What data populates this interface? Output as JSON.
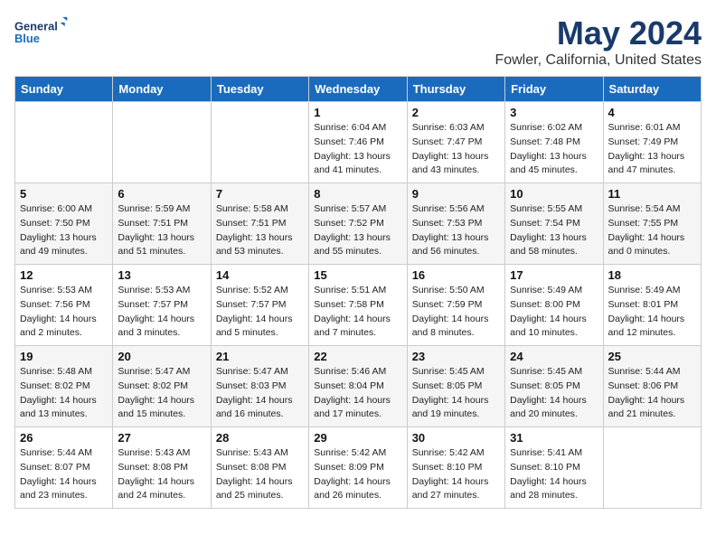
{
  "logo": {
    "line1": "General",
    "line2": "Blue"
  },
  "title": "May 2024",
  "subtitle": "Fowler, California, United States",
  "days_of_week": [
    "Sunday",
    "Monday",
    "Tuesday",
    "Wednesday",
    "Thursday",
    "Friday",
    "Saturday"
  ],
  "weeks": [
    [
      {
        "day": "",
        "sunrise": "",
        "sunset": "",
        "daylight": ""
      },
      {
        "day": "",
        "sunrise": "",
        "sunset": "",
        "daylight": ""
      },
      {
        "day": "",
        "sunrise": "",
        "sunset": "",
        "daylight": ""
      },
      {
        "day": "1",
        "sunrise": "Sunrise: 6:04 AM",
        "sunset": "Sunset: 7:46 PM",
        "daylight": "Daylight: 13 hours and 41 minutes."
      },
      {
        "day": "2",
        "sunrise": "Sunrise: 6:03 AM",
        "sunset": "Sunset: 7:47 PM",
        "daylight": "Daylight: 13 hours and 43 minutes."
      },
      {
        "day": "3",
        "sunrise": "Sunrise: 6:02 AM",
        "sunset": "Sunset: 7:48 PM",
        "daylight": "Daylight: 13 hours and 45 minutes."
      },
      {
        "day": "4",
        "sunrise": "Sunrise: 6:01 AM",
        "sunset": "Sunset: 7:49 PM",
        "daylight": "Daylight: 13 hours and 47 minutes."
      }
    ],
    [
      {
        "day": "5",
        "sunrise": "Sunrise: 6:00 AM",
        "sunset": "Sunset: 7:50 PM",
        "daylight": "Daylight: 13 hours and 49 minutes."
      },
      {
        "day": "6",
        "sunrise": "Sunrise: 5:59 AM",
        "sunset": "Sunset: 7:51 PM",
        "daylight": "Daylight: 13 hours and 51 minutes."
      },
      {
        "day": "7",
        "sunrise": "Sunrise: 5:58 AM",
        "sunset": "Sunset: 7:51 PM",
        "daylight": "Daylight: 13 hours and 53 minutes."
      },
      {
        "day": "8",
        "sunrise": "Sunrise: 5:57 AM",
        "sunset": "Sunset: 7:52 PM",
        "daylight": "Daylight: 13 hours and 55 minutes."
      },
      {
        "day": "9",
        "sunrise": "Sunrise: 5:56 AM",
        "sunset": "Sunset: 7:53 PM",
        "daylight": "Daylight: 13 hours and 56 minutes."
      },
      {
        "day": "10",
        "sunrise": "Sunrise: 5:55 AM",
        "sunset": "Sunset: 7:54 PM",
        "daylight": "Daylight: 13 hours and 58 minutes."
      },
      {
        "day": "11",
        "sunrise": "Sunrise: 5:54 AM",
        "sunset": "Sunset: 7:55 PM",
        "daylight": "Daylight: 14 hours and 0 minutes."
      }
    ],
    [
      {
        "day": "12",
        "sunrise": "Sunrise: 5:53 AM",
        "sunset": "Sunset: 7:56 PM",
        "daylight": "Daylight: 14 hours and 2 minutes."
      },
      {
        "day": "13",
        "sunrise": "Sunrise: 5:53 AM",
        "sunset": "Sunset: 7:57 PM",
        "daylight": "Daylight: 14 hours and 3 minutes."
      },
      {
        "day": "14",
        "sunrise": "Sunrise: 5:52 AM",
        "sunset": "Sunset: 7:57 PM",
        "daylight": "Daylight: 14 hours and 5 minutes."
      },
      {
        "day": "15",
        "sunrise": "Sunrise: 5:51 AM",
        "sunset": "Sunset: 7:58 PM",
        "daylight": "Daylight: 14 hours and 7 minutes."
      },
      {
        "day": "16",
        "sunrise": "Sunrise: 5:50 AM",
        "sunset": "Sunset: 7:59 PM",
        "daylight": "Daylight: 14 hours and 8 minutes."
      },
      {
        "day": "17",
        "sunrise": "Sunrise: 5:49 AM",
        "sunset": "Sunset: 8:00 PM",
        "daylight": "Daylight: 14 hours and 10 minutes."
      },
      {
        "day": "18",
        "sunrise": "Sunrise: 5:49 AM",
        "sunset": "Sunset: 8:01 PM",
        "daylight": "Daylight: 14 hours and 12 minutes."
      }
    ],
    [
      {
        "day": "19",
        "sunrise": "Sunrise: 5:48 AM",
        "sunset": "Sunset: 8:02 PM",
        "daylight": "Daylight: 14 hours and 13 minutes."
      },
      {
        "day": "20",
        "sunrise": "Sunrise: 5:47 AM",
        "sunset": "Sunset: 8:02 PM",
        "daylight": "Daylight: 14 hours and 15 minutes."
      },
      {
        "day": "21",
        "sunrise": "Sunrise: 5:47 AM",
        "sunset": "Sunset: 8:03 PM",
        "daylight": "Daylight: 14 hours and 16 minutes."
      },
      {
        "day": "22",
        "sunrise": "Sunrise: 5:46 AM",
        "sunset": "Sunset: 8:04 PM",
        "daylight": "Daylight: 14 hours and 17 minutes."
      },
      {
        "day": "23",
        "sunrise": "Sunrise: 5:45 AM",
        "sunset": "Sunset: 8:05 PM",
        "daylight": "Daylight: 14 hours and 19 minutes."
      },
      {
        "day": "24",
        "sunrise": "Sunrise: 5:45 AM",
        "sunset": "Sunset: 8:05 PM",
        "daylight": "Daylight: 14 hours and 20 minutes."
      },
      {
        "day": "25",
        "sunrise": "Sunrise: 5:44 AM",
        "sunset": "Sunset: 8:06 PM",
        "daylight": "Daylight: 14 hours and 21 minutes."
      }
    ],
    [
      {
        "day": "26",
        "sunrise": "Sunrise: 5:44 AM",
        "sunset": "Sunset: 8:07 PM",
        "daylight": "Daylight: 14 hours and 23 minutes."
      },
      {
        "day": "27",
        "sunrise": "Sunrise: 5:43 AM",
        "sunset": "Sunset: 8:08 PM",
        "daylight": "Daylight: 14 hours and 24 minutes."
      },
      {
        "day": "28",
        "sunrise": "Sunrise: 5:43 AM",
        "sunset": "Sunset: 8:08 PM",
        "daylight": "Daylight: 14 hours and 25 minutes."
      },
      {
        "day": "29",
        "sunrise": "Sunrise: 5:42 AM",
        "sunset": "Sunset: 8:09 PM",
        "daylight": "Daylight: 14 hours and 26 minutes."
      },
      {
        "day": "30",
        "sunrise": "Sunrise: 5:42 AM",
        "sunset": "Sunset: 8:10 PM",
        "daylight": "Daylight: 14 hours and 27 minutes."
      },
      {
        "day": "31",
        "sunrise": "Sunrise: 5:41 AM",
        "sunset": "Sunset: 8:10 PM",
        "daylight": "Daylight: 14 hours and 28 minutes."
      },
      {
        "day": "",
        "sunrise": "",
        "sunset": "",
        "daylight": ""
      }
    ]
  ]
}
